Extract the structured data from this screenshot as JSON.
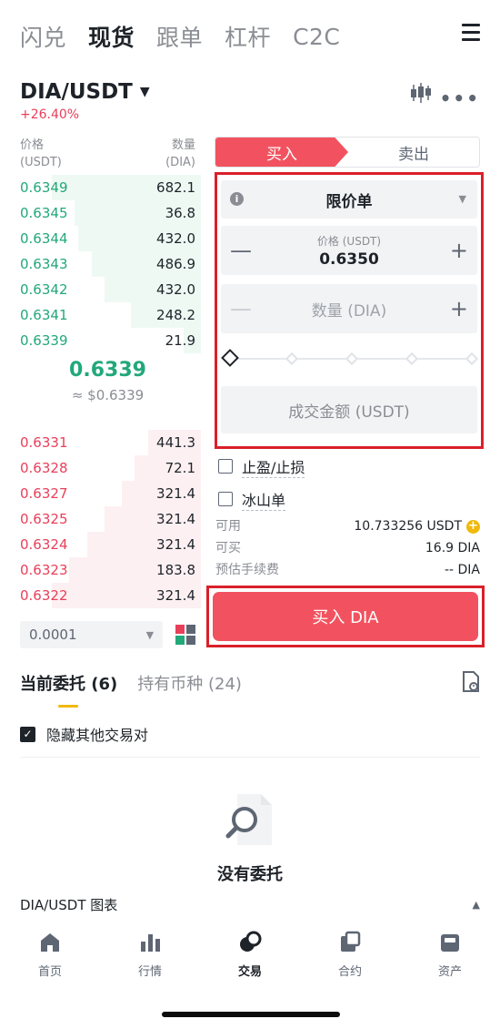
{
  "top_tabs": [
    "闪兑",
    "现货",
    "跟单",
    "杠杆",
    "C2C"
  ],
  "pair": {
    "name": "DIA/USDT",
    "change": "+26.40%"
  },
  "orderbook": {
    "price_header": [
      "价格",
      "(USDT)"
    ],
    "qty_header": [
      "数量",
      "(DIA)"
    ],
    "asks": [
      {
        "price": "0.6349",
        "qty": "682.1",
        "depth": 0.85
      },
      {
        "price": "0.6345",
        "qty": "36.8",
        "depth": 0.72
      },
      {
        "price": "0.6344",
        "qty": "432.0",
        "depth": 0.7
      },
      {
        "price": "0.6343",
        "qty": "486.9",
        "depth": 0.62
      },
      {
        "price": "0.6342",
        "qty": "432.0",
        "depth": 0.55
      },
      {
        "price": "0.6341",
        "qty": "248.2",
        "depth": 0.4
      },
      {
        "price": "0.6339",
        "qty": "21.9",
        "depth": 0.1
      }
    ],
    "last_price": "0.6339",
    "fiat": "≈ $0.6339",
    "bids": [
      {
        "price": "0.6331",
        "qty": "441.3",
        "depth": 0.3
      },
      {
        "price": "0.6328",
        "qty": "72.1",
        "depth": 0.38
      },
      {
        "price": "0.6327",
        "qty": "321.4",
        "depth": 0.45
      },
      {
        "price": "0.6325",
        "qty": "321.4",
        "depth": 0.55
      },
      {
        "price": "0.6324",
        "qty": "321.4",
        "depth": 0.65
      },
      {
        "price": "0.6323",
        "qty": "183.8",
        "depth": 0.75
      },
      {
        "price": "0.6322",
        "qty": "321.4",
        "depth": 0.85
      }
    ],
    "step": "0.0001"
  },
  "form": {
    "buy_tab": "买入",
    "sell_tab": "卖出",
    "order_type": "限价单",
    "price_label": "价格 (USDT)",
    "price_value": "0.6350",
    "qty_placeholder": "数量 (DIA)",
    "total_placeholder": "成交金额 (USDT)",
    "tp_sl": "止盈/止损",
    "iceberg": "冰山单",
    "available_label": "可用",
    "available_value": "10.733256 USDT",
    "can_buy_label": "可买",
    "can_buy_value": "16.9 DIA",
    "fee_label": "预估手续费",
    "fee_value": "-- DIA",
    "submit": "买入 DIA"
  },
  "orders": {
    "tab_open": "当前委托 (6)",
    "tab_holdings": "持有币种 (24)",
    "hide_others": "隐藏其他交易对",
    "empty": "没有委托"
  },
  "chart_bar": "DIA/USDT 图表",
  "bottom_nav": [
    "首页",
    "行情",
    "交易",
    "合约",
    "资产"
  ],
  "colors": {
    "buy": "#f2525f",
    "ask": "#22a87a",
    "bid": "#e8405a",
    "accent": "#f0b90b",
    "highlight_box": "#d9202a"
  }
}
